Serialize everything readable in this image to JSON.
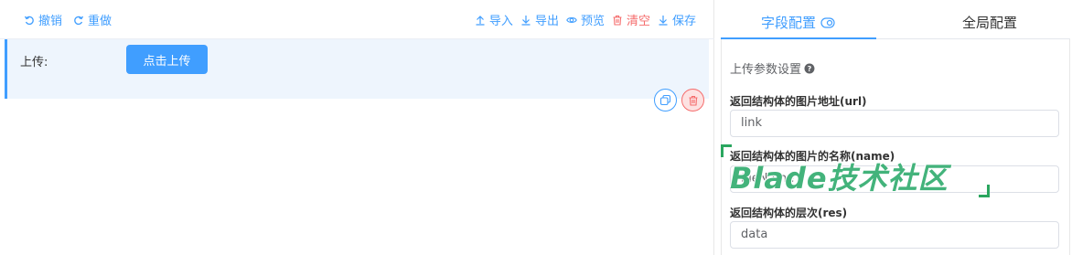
{
  "toolbar": {
    "undo_label": "撤销",
    "redo_label": "重做",
    "import_label": "导入",
    "export_label": "导出",
    "preview_label": "预览",
    "clear_label": "清空",
    "save_label": "保存"
  },
  "form": {
    "upload_label": "上传:",
    "upload_button": "点击上传"
  },
  "config_panel": {
    "tabs": [
      {
        "label": "字段配置",
        "active": true
      },
      {
        "label": "全局配置",
        "active": false
      }
    ],
    "section_title": "上传参数设置",
    "fields": [
      {
        "label": "返回结构体的图片地址(url)",
        "value": "link"
      },
      {
        "label": "返回结构体的图片的名称(name)",
        "value": "fileName"
      },
      {
        "label": "返回结构体的层次(res)",
        "value": "data"
      }
    ]
  },
  "watermark": {
    "text": "Blade技术社区"
  },
  "colors": {
    "primary": "#409eff",
    "danger": "#f56c6c",
    "watermark_green": "#2aa65f",
    "form_item_bg": "#eef5fd"
  }
}
